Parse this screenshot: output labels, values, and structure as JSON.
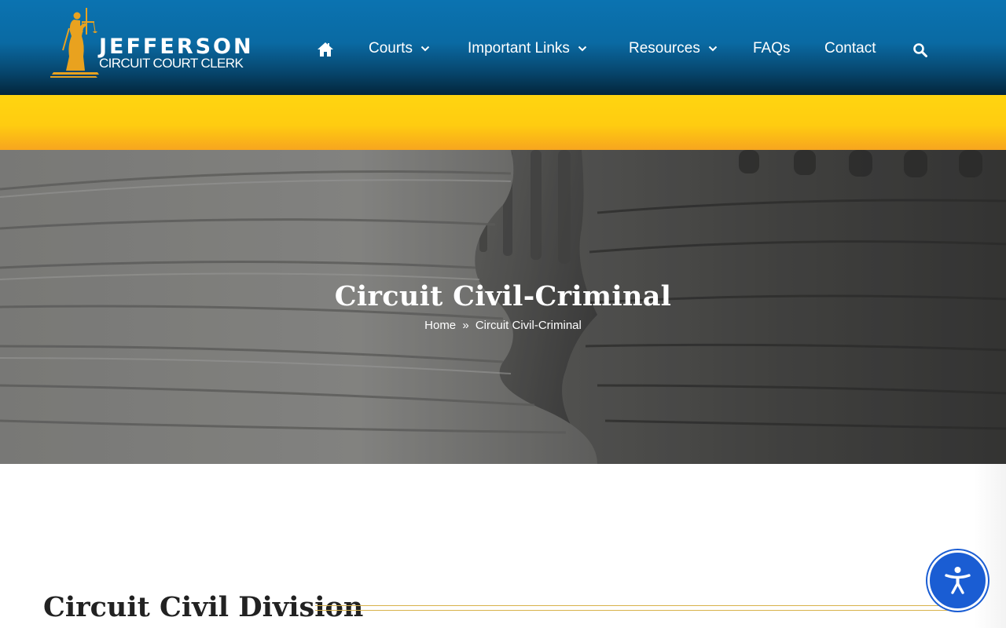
{
  "header": {
    "logo": {
      "title": "JEFFERSON",
      "subtitle": "CIRCUIT COURT CLERK"
    },
    "nav": {
      "home_icon": "home-icon",
      "items": [
        {
          "label": "Courts",
          "has_dropdown": true
        },
        {
          "label": "Important Links",
          "has_dropdown": true
        },
        {
          "label": "Resources",
          "has_dropdown": true
        },
        {
          "label": "FAQs",
          "has_dropdown": false
        },
        {
          "label": "Contact",
          "has_dropdown": false
        }
      ],
      "search_icon": "search-icon"
    }
  },
  "hero": {
    "title": "Circuit Civil-Criminal",
    "breadcrumb": {
      "home": "Home",
      "separator": "»",
      "current": "Circuit Civil-Criminal"
    }
  },
  "main": {
    "section_title": "Circuit Civil Division"
  },
  "accessibility_button": {
    "icon": "accessibility-icon"
  },
  "colors": {
    "header_blue": "#0b73b1",
    "band_yellow": "#ffd510",
    "band_orange": "#f7a51f",
    "logo_gold": "#e9a21f",
    "divider_gold": "#d8b24a",
    "a11y_blue": "#1a5dd3"
  }
}
